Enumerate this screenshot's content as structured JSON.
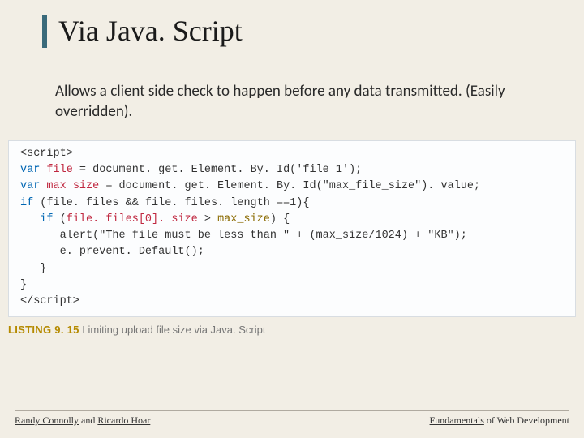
{
  "title": "Via Java. Script",
  "body": "Allows a client side check to happen before any data transmitted. (Easily overridden).",
  "code": {
    "open_tag": "<script>",
    "l1_a": "var",
    "l1_b": " file",
    "l1_c": " = document. get. Element. By. Id('file 1');",
    "l2_a": "var",
    "l2_b": " max size",
    "l2_c": " = document. get. Element. By. Id(\"max_file_size\"). value;",
    "l3_a": "if",
    "l3_b": " (file. files && file. files. length ==1){",
    "l4_a": "   if",
    "l4_b": " (",
    "l4_c": "file. files[0]. size",
    "l4_d": " > ",
    "l4_e": "max_size",
    "l4_f": ") {",
    "l5": "      alert(\"The file must be less than \" + (max_size/1024) + \"KB\");",
    "l6": "      e. prevent. Default();",
    "l7": "   }",
    "l8": "}",
    "close_tag": "</script>"
  },
  "caption": {
    "label": "LISTING 9. 15",
    "text": " Limiting upload file size via Java. Script"
  },
  "footer": {
    "left_a": "Randy Connolly",
    "left_mid": " and ",
    "left_b": "Ricardo Hoar",
    "right_a": "Fundamentals",
    "right_b": " of Web Development"
  }
}
